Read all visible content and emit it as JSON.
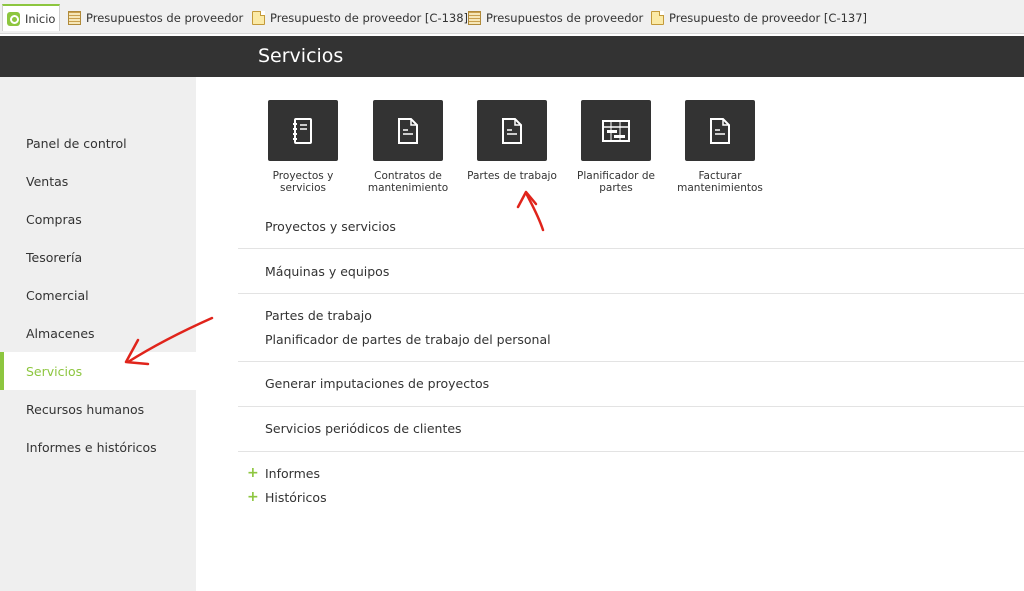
{
  "tabs": [
    {
      "label": "Inicio",
      "icon": "home-icon"
    },
    {
      "label": "Presupuestos de proveedor",
      "icon": "table-icon"
    },
    {
      "label": "Presupuesto de proveedor [C-138]",
      "icon": "document-icon"
    },
    {
      "label": "Presupuestos de proveedor",
      "icon": "table-icon"
    },
    {
      "label": "Presupuesto de proveedor [C-137]",
      "icon": "document-icon"
    }
  ],
  "header": {
    "title": "Servicios"
  },
  "sidebar": {
    "items": [
      {
        "label": "Panel de control"
      },
      {
        "label": "Ventas"
      },
      {
        "label": "Compras"
      },
      {
        "label": "Tesorería"
      },
      {
        "label": "Comercial"
      },
      {
        "label": "Almacenes"
      },
      {
        "label": "Servicios"
      },
      {
        "label": "Recursos humanos"
      },
      {
        "label": "Informes e históricos"
      }
    ],
    "active": "Servicios"
  },
  "tiles": [
    {
      "line1": "Proyectos y",
      "line2": "servicios",
      "icon": "notebook-icon"
    },
    {
      "line1": "Contratos de",
      "line2": "mantenimiento",
      "icon": "document-icon"
    },
    {
      "line1": "Partes de trabajo",
      "line2": "",
      "icon": "document-icon"
    },
    {
      "line1": "Planificador de",
      "line2": "partes",
      "icon": "gantt-icon"
    },
    {
      "line1": "Facturar",
      "line2": "mantenimientos",
      "icon": "document-icon"
    }
  ],
  "sections": [
    {
      "items": [
        "Proyectos y servicios"
      ]
    },
    {
      "items": [
        "Máquinas y equipos"
      ]
    },
    {
      "items": [
        "Partes de trabajo",
        "Planificador de partes de trabajo del personal"
      ]
    },
    {
      "items": [
        "Generar imputaciones de proyectos"
      ]
    },
    {
      "items": [
        "Servicios periódicos de clientes"
      ]
    }
  ],
  "expandables": [
    {
      "label": "Informes",
      "symbol": "+"
    },
    {
      "label": "Históricos",
      "symbol": "+"
    }
  ],
  "colors": {
    "accent": "#8dc63f",
    "header": "#333333",
    "annotation": "#e0241b"
  }
}
